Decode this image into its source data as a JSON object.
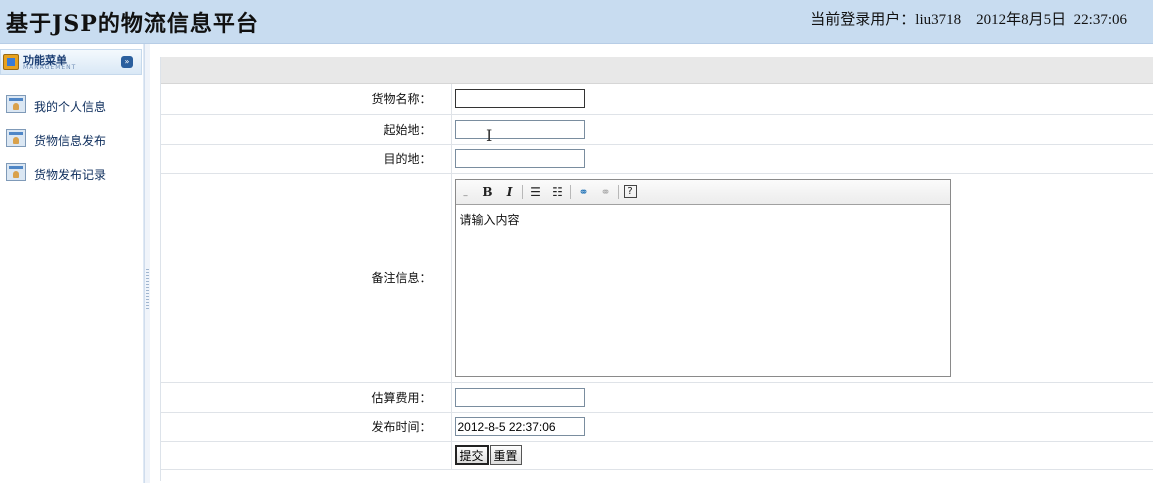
{
  "header": {
    "title": "基于JSP的物流信息平台",
    "login_label": "当前登录用户：",
    "username": "liu3718",
    "date": "2012年8月5日",
    "time": "22:37:06"
  },
  "sidebar": {
    "menu_title": "功能菜单",
    "menu_subtitle": "MANAGEMENT",
    "items": [
      {
        "label": "我的个人信息"
      },
      {
        "label": "货物信息发布"
      },
      {
        "label": "货物发布记录"
      }
    ]
  },
  "form": {
    "goods_name": {
      "label": "货物名称：",
      "value": ""
    },
    "origin": {
      "label": "起始地：",
      "value": ""
    },
    "destination": {
      "label": "目的地：",
      "value": ""
    },
    "remarks": {
      "label": "备注信息：",
      "placeholder": "请输入内容"
    },
    "estimated_cost": {
      "label": "估算费用：",
      "value": ""
    },
    "publish_time": {
      "label": "发布时间：",
      "value": "2012-8-5 22:37:06"
    },
    "submit_label": "提交",
    "reset_label": "重置"
  },
  "editor_toolbar": {
    "bold": "B",
    "italic": "I",
    "help": "?"
  }
}
